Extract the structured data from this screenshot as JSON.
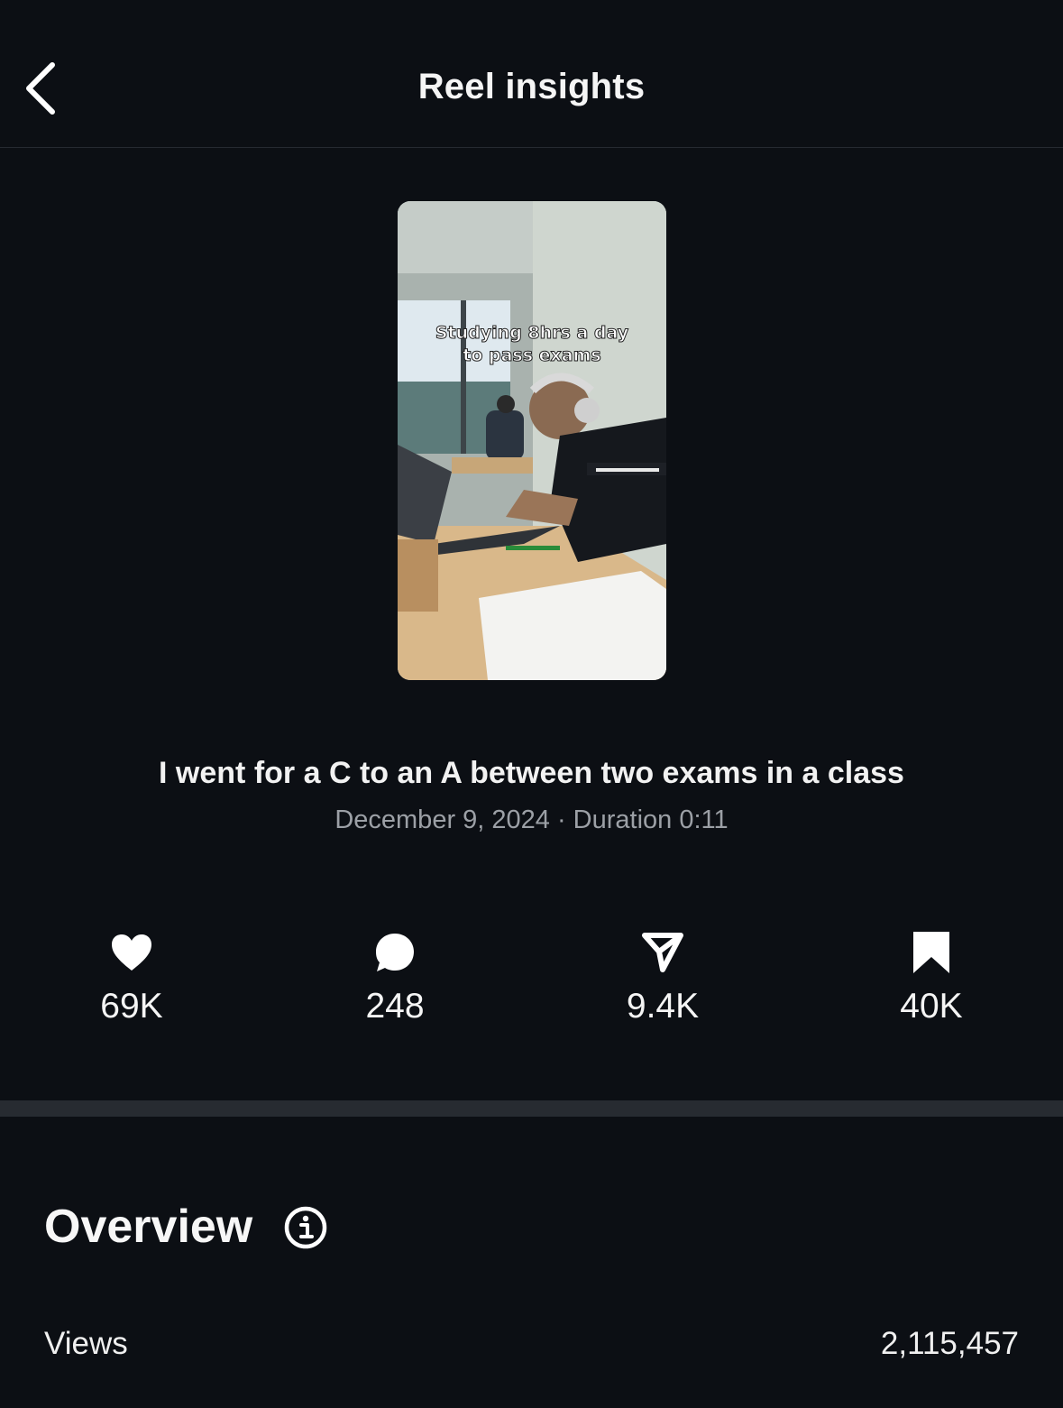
{
  "header": {
    "title": "Reel insights",
    "back_icon": "chevron-left-icon"
  },
  "reel": {
    "thumbnail_overlay_line1": "Studying 8hrs a day",
    "thumbnail_overlay_line2": "to pass exams",
    "caption": "I went for a C to an A between two exams in a class",
    "meta": "December 9, 2024 · Duration 0:11"
  },
  "stats": [
    {
      "icon": "heart-icon",
      "value": "69K"
    },
    {
      "icon": "comment-icon",
      "value": "248"
    },
    {
      "icon": "share-icon",
      "value": "9.4K"
    },
    {
      "icon": "bookmark-icon",
      "value": "40K"
    }
  ],
  "overview": {
    "title": "Overview",
    "info_icon": "info-icon",
    "rows": [
      {
        "label": "Views",
        "value": "2,115,457"
      }
    ]
  },
  "colors": {
    "background": "#0c0f14",
    "text_primary": "#f5f5f5",
    "text_secondary": "#9ca0a6",
    "divider": "#272b31"
  }
}
